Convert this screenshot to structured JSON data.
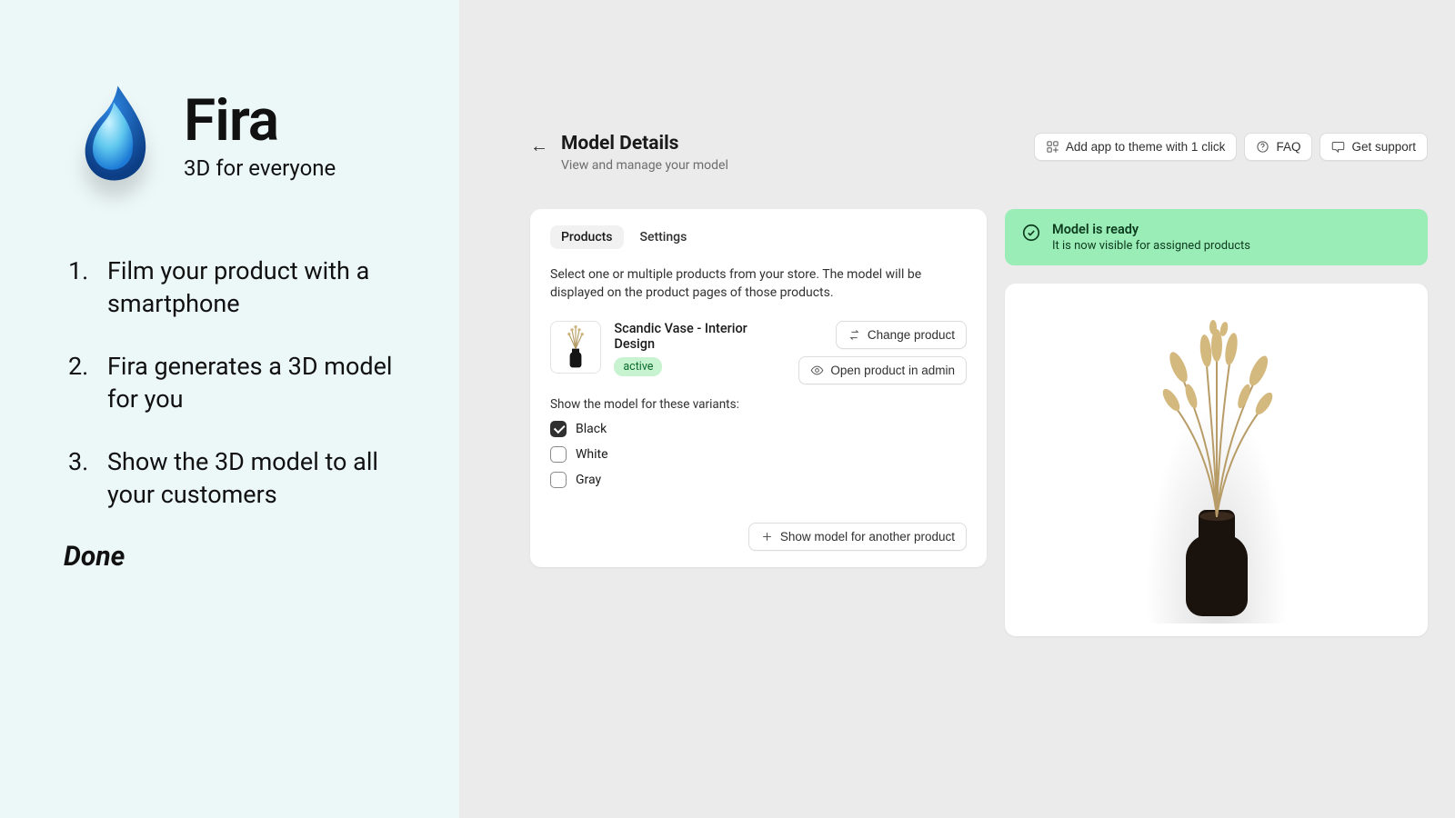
{
  "brand": {
    "name": "Fira",
    "tagline": "3D for everyone"
  },
  "steps": [
    "Film your product with a smartphone",
    "Fira generates a 3D model for you",
    "Show the 3D model to all your customers"
  ],
  "steps_done": "Done",
  "page": {
    "title": "Model Details",
    "subtitle": "View and manage your model"
  },
  "header_actions": {
    "add_theme": "Add app to theme with 1 click",
    "faq": "FAQ",
    "support": "Get support"
  },
  "tabs": {
    "products": "Products",
    "settings": "Settings",
    "active": "products"
  },
  "help_text": "Select one or multiple products from your store. The model will be displayed on the product pages of those products.",
  "product": {
    "name": "Scandic Vase - Interior Design",
    "status": "active"
  },
  "product_actions": {
    "change": "Change product",
    "open_admin": "Open product in admin"
  },
  "variants": {
    "label": "Show the model for these variants:",
    "items": [
      {
        "label": "Black",
        "checked": true
      },
      {
        "label": "White",
        "checked": false
      },
      {
        "label": "Gray",
        "checked": false
      }
    ]
  },
  "show_another": "Show model for another product",
  "status_banner": {
    "title": "Model is ready",
    "subtitle": "It is now visible for assigned products"
  }
}
